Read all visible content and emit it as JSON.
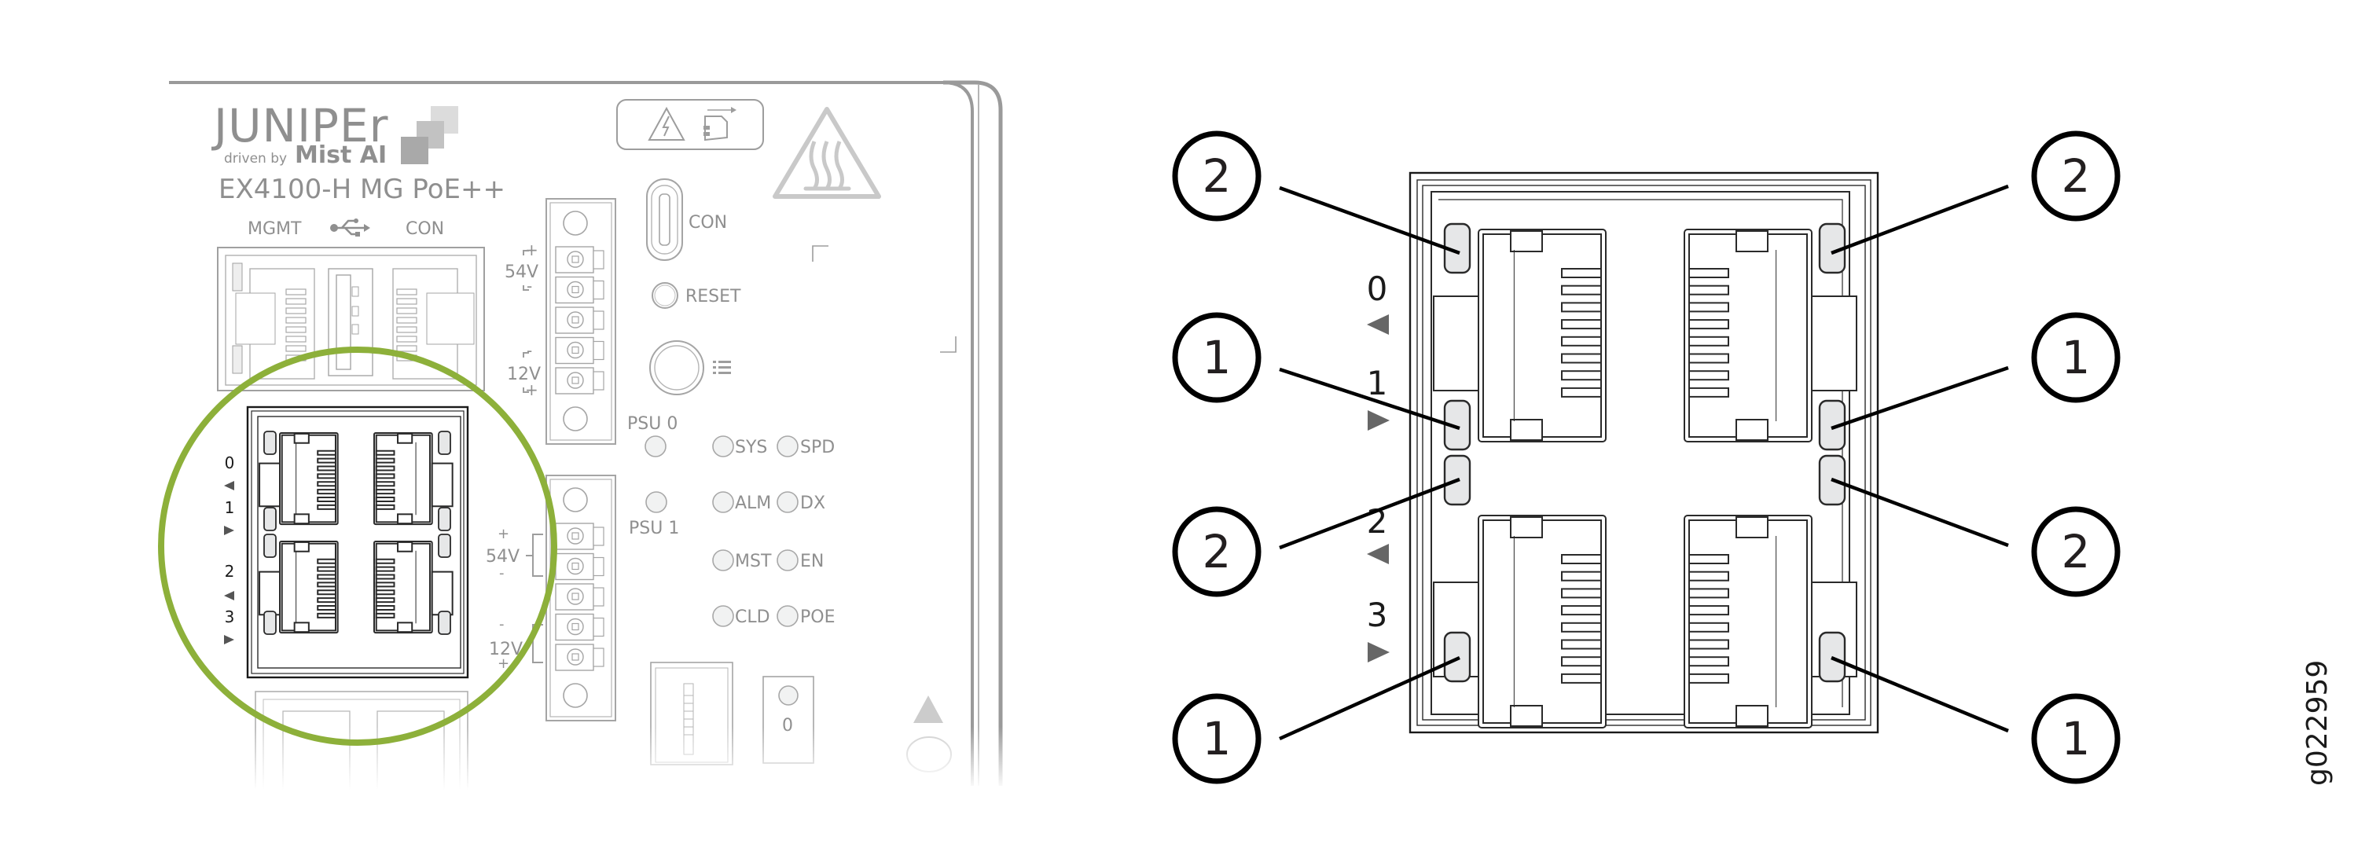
{
  "device": {
    "brand": "JUNIPEr",
    "brand_tagline_prefix": "driven by",
    "brand_tagline": "Mist AI",
    "model": "EX4100-H MG PoE++",
    "port_labels": {
      "mgmt": "MGMT",
      "usb_icon": "usb-icon",
      "con": "CON"
    },
    "console_label": "CON",
    "reset_label": "RESET",
    "locate_icon": "list-icon",
    "psu": [
      {
        "label": "PSU 0",
        "connector": {
          "upper_voltage": "54V",
          "upper_signs": [
            "+",
            "-"
          ],
          "lower_voltage": "12V",
          "lower_signs": [
            "-",
            "+"
          ]
        }
      },
      {
        "label": "PSU 1",
        "connector": {
          "upper_voltage": "54V",
          "upper_signs": [
            "+",
            "-"
          ],
          "lower_voltage": "12V",
          "lower_signs": [
            "-",
            "+"
          ]
        }
      }
    ],
    "status_leds": [
      {
        "left": "SYS",
        "right": "SPD"
      },
      {
        "left": "ALM",
        "right": "DX"
      },
      {
        "left": "MST",
        "right": "EN"
      },
      {
        "left": "CLD",
        "right": "POE"
      }
    ],
    "slot_label": "0",
    "warning_icons": [
      "electrical-hazard-icon",
      "disconnect-power-icon",
      "hot-surface-icon",
      "esd-icon"
    ],
    "highlight_color": "#8db03a",
    "uplink_port_numbers": [
      "0",
      "1",
      "2",
      "3"
    ],
    "uplink_port_arrows": [
      "left",
      "right",
      "left",
      "right"
    ]
  },
  "detail": {
    "port_numbers": [
      "0",
      "1",
      "2",
      "3"
    ],
    "port_arrows": [
      "left",
      "right",
      "left",
      "right"
    ],
    "callouts_left": [
      "2",
      "1",
      "2",
      "1"
    ],
    "callouts_right": [
      "2",
      "1",
      "2",
      "1"
    ],
    "led_fill_color": "#e6e7e8"
  },
  "figure_id": "g022959"
}
